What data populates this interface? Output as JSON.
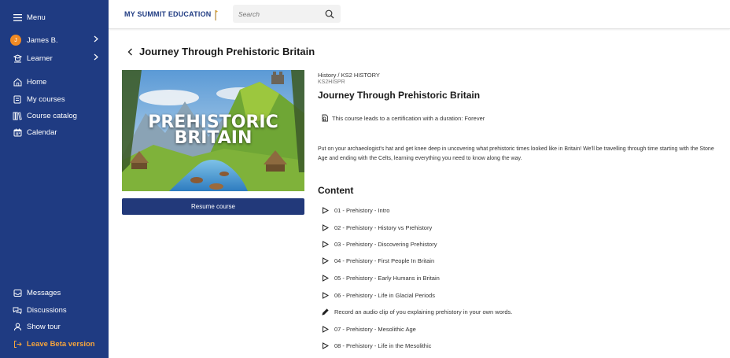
{
  "sidebar": {
    "menu_label": "Menu",
    "user": {
      "initial": "J",
      "name": "James B."
    },
    "learner_label": "Learner",
    "nav": [
      {
        "label": "Home",
        "icon": "home-icon"
      },
      {
        "label": "My courses",
        "icon": "book-icon"
      },
      {
        "label": "Course catalog",
        "icon": "catalog-icon"
      },
      {
        "label": "Calendar",
        "icon": "calendar-icon"
      }
    ],
    "bottom": [
      {
        "label": "Messages",
        "icon": "inbox-icon"
      },
      {
        "label": "Discussions",
        "icon": "discussion-icon"
      },
      {
        "label": "Show tour",
        "icon": "tour-icon"
      },
      {
        "label": "Leave Beta version",
        "icon": "leave-beta-icon"
      }
    ]
  },
  "header": {
    "logo_text": "MY SUMMIT EDUCATION",
    "search_placeholder": "Search"
  },
  "page": {
    "title": "Journey Through Prehistoric Britain",
    "hero_text_line1": "PREHISTORIC",
    "hero_text_line2": "BRITAIN",
    "resume_label": "Resume course"
  },
  "course": {
    "breadcrumb": "History / KS2 HISTORY",
    "code": "KS2HISPR",
    "title": "Journey Through Prehistoric Britain",
    "certification": "This course leads to a certification with a duration: Forever",
    "description": "Put on your archaeologist's hat and get knee deep in uncovering what prehistoric times looked like in Britain! We'll be travelling through time starting with the Stone Age and ending with the Celts, learning everything you need to know along the way.",
    "content_heading": "Content",
    "items": [
      {
        "label": "01 - Prehistory - Intro",
        "type": "video"
      },
      {
        "label": "02 - Prehistory - History vs Prehistory",
        "type": "video"
      },
      {
        "label": "03 - Prehistory - Discovering Prehistory",
        "type": "video"
      },
      {
        "label": "04 - Prehistory - First People In Britain",
        "type": "video"
      },
      {
        "label": "05 - Prehistory - Early Humans in Britain",
        "type": "video"
      },
      {
        "label": "06 - Prehistory - Life in Glacial Periods",
        "type": "video"
      },
      {
        "label": "Record an audio clip of you explaining prehistory in your own words.",
        "type": "assignment"
      },
      {
        "label": "07 - Prehistory - Mesolithic Age",
        "type": "video"
      },
      {
        "label": "08 - Prehistory - Life in the Mesolithic",
        "type": "video"
      }
    ]
  },
  "colors": {
    "sidebar_bg": "#1f3b82",
    "button_bg": "#22397a",
    "beta_accent": "#f5a43c",
    "avatar_bg": "#f08a24"
  }
}
